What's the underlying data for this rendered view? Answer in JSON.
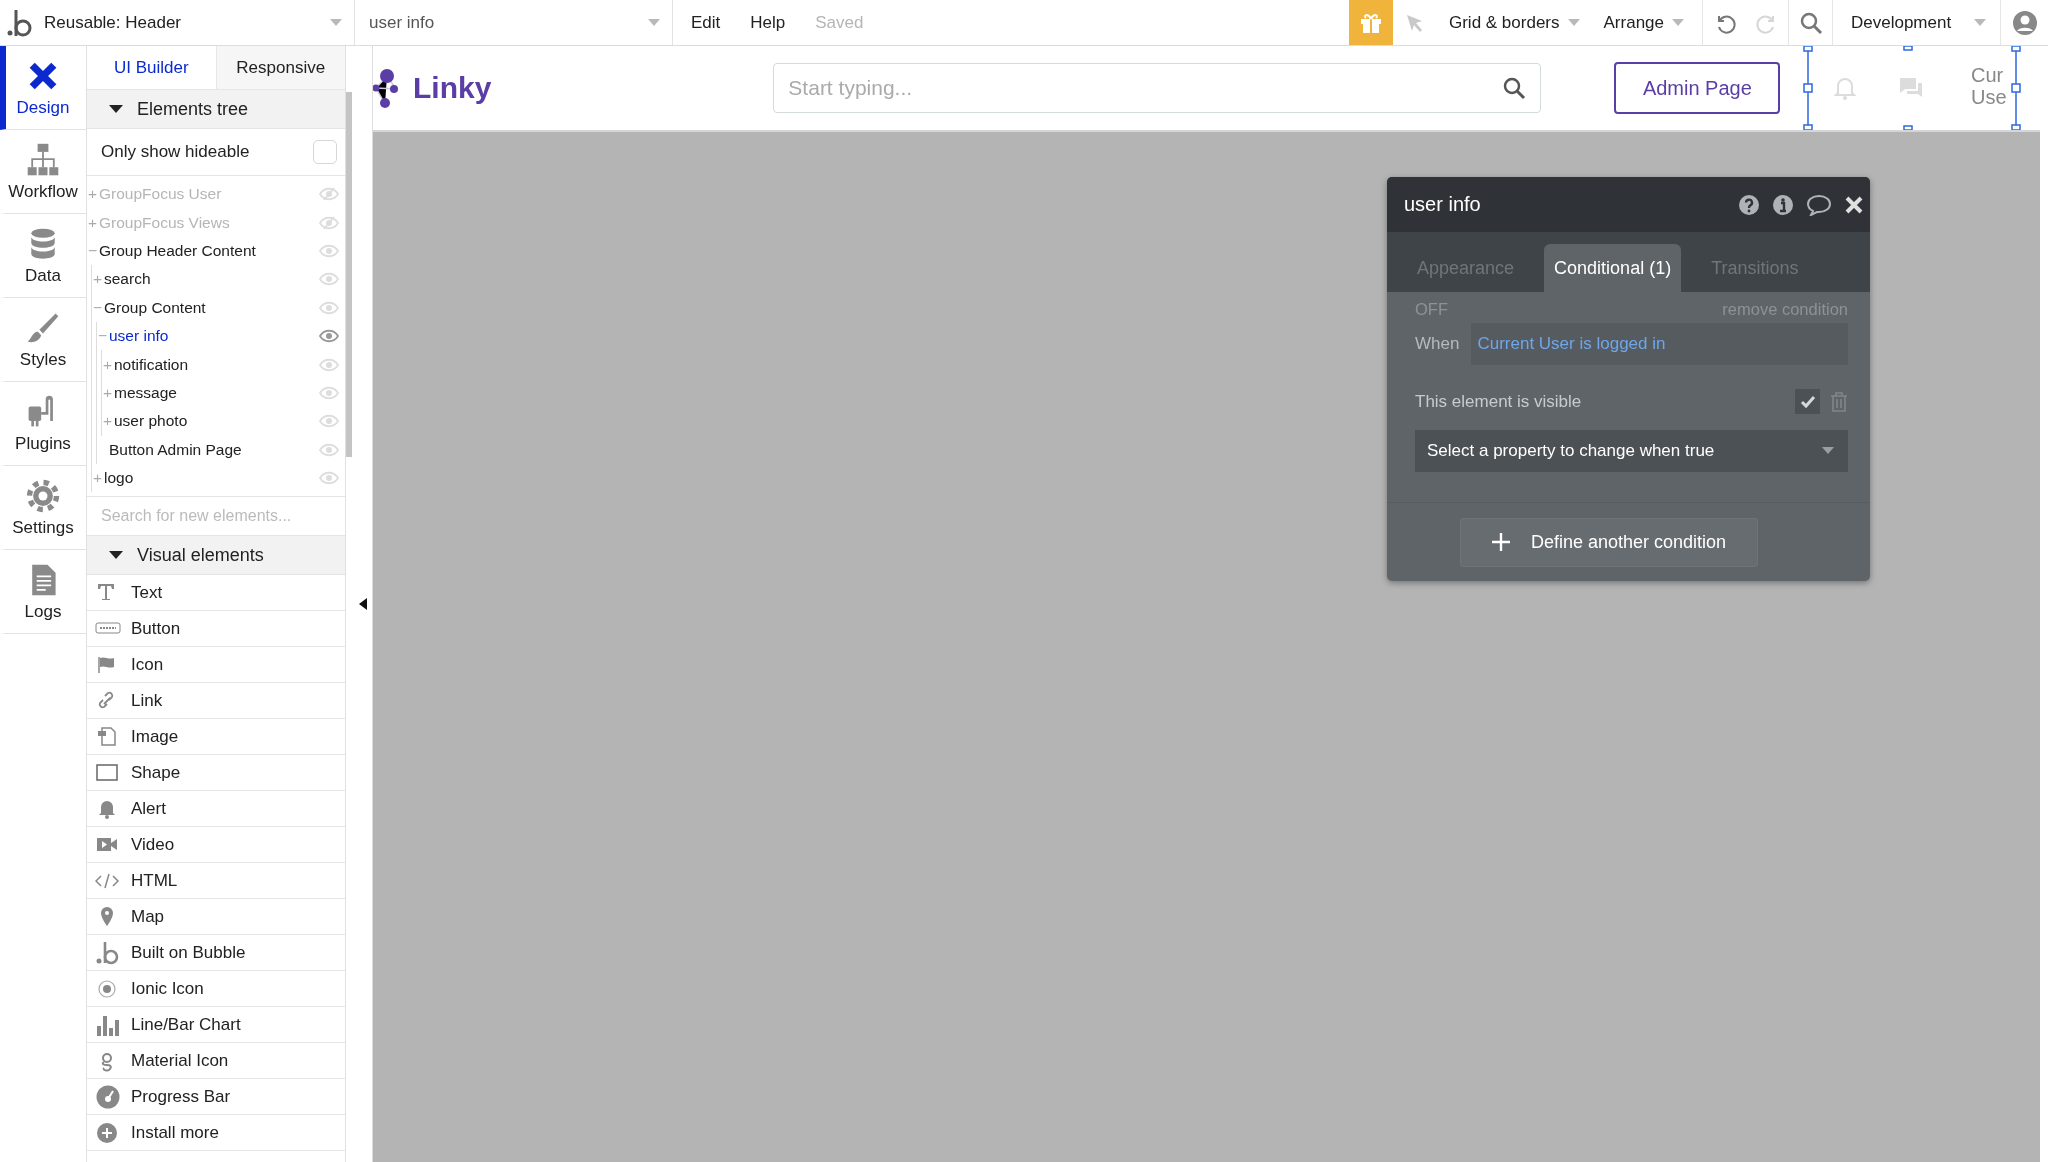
{
  "topbar": {
    "page_selector": "Reusable: Header",
    "element_selector": "user info",
    "menus": [
      {
        "label": "Edit"
      },
      {
        "label": "Help"
      }
    ],
    "save_status": "Saved",
    "grid_menu": "Grid & borders",
    "arrange_menu": "Arrange",
    "redo_disabled": true,
    "environment": "Development"
  },
  "nav": [
    {
      "label": "Design",
      "kind": "design",
      "selected": true
    },
    {
      "label": "Workflow",
      "kind": "workflow",
      "selected": false
    },
    {
      "label": "Data",
      "kind": "data",
      "selected": false
    },
    {
      "label": "Styles",
      "kind": "styles",
      "selected": false
    },
    {
      "label": "Plugins",
      "kind": "plugins",
      "selected": false
    },
    {
      "label": "Settings",
      "kind": "settings",
      "selected": false
    },
    {
      "label": "Logs",
      "kind": "logs",
      "selected": false
    }
  ],
  "panel": {
    "tabs": [
      {
        "label": "UI Builder",
        "selected": true
      },
      {
        "label": "Responsive",
        "selected": false
      }
    ],
    "tree_header": "Elements tree",
    "hideable_filter": {
      "label": "Only show hideable",
      "checked": false
    },
    "tree": [
      {
        "label": "GroupFocus User",
        "toggle": "+",
        "hidden": true,
        "selected": false
      },
      {
        "label": "GroupFocus Views",
        "toggle": "+",
        "hidden": true,
        "selected": false
      },
      {
        "label": "Group Header Content",
        "toggle": "−",
        "hidden": false,
        "selected": false,
        "children": [
          {
            "label": "search",
            "toggle": "+",
            "hidden": false,
            "selected": false
          },
          {
            "label": "Group Content",
            "toggle": "−",
            "hidden": false,
            "selected": false,
            "children": [
              {
                "label": "user info",
                "toggle": "−",
                "hidden": false,
                "selected": true,
                "children": [
                  {
                    "label": "notification",
                    "toggle": "+",
                    "hidden": false,
                    "selected": false
                  },
                  {
                    "label": "message",
                    "toggle": "+",
                    "hidden": false,
                    "selected": false
                  },
                  {
                    "label": "user photo",
                    "toggle": "+",
                    "hidden": false,
                    "selected": false
                  }
                ]
              },
              {
                "label": "Button Admin Page",
                "hidden": false,
                "selected": false
              }
            ]
          },
          {
            "label": "logo",
            "toggle": "+",
            "hidden": false,
            "selected": false
          }
        ]
      }
    ],
    "search_placeholder": "Search for new elements...",
    "visual_header": "Visual elements",
    "visual_elements": [
      {
        "label": "Text",
        "kind": "text"
      },
      {
        "label": "Button",
        "kind": "button"
      },
      {
        "label": "Icon",
        "kind": "flag"
      },
      {
        "label": "Link",
        "kind": "link"
      },
      {
        "label": "Image",
        "kind": "image"
      },
      {
        "label": "Shape",
        "kind": "shape"
      },
      {
        "label": "Alert",
        "kind": "bell"
      },
      {
        "label": "Video",
        "kind": "video"
      },
      {
        "label": "HTML",
        "kind": "code"
      },
      {
        "label": "Map",
        "kind": "pin"
      },
      {
        "label": "Built on Bubble",
        "kind": "bubble"
      },
      {
        "label": "Ionic Icon",
        "kind": "ionic"
      },
      {
        "label": "Line/Bar Chart",
        "kind": "chart"
      },
      {
        "label": "Material Icon",
        "kind": "material"
      },
      {
        "label": "Progress Bar",
        "kind": "gauge"
      },
      {
        "label": "Install more",
        "kind": "plus"
      }
    ]
  },
  "canvas": {
    "logo_text": "Linky",
    "search_placeholder": "Start typing...",
    "admin_button": "Admin Page",
    "user_text": [
      "Cur",
      "Use"
    ]
  },
  "popup": {
    "title": "user info",
    "tabs": [
      {
        "label": "Appearance",
        "selected": false
      },
      {
        "label": "Conditional (1)",
        "selected": true
      },
      {
        "label": "Transitions",
        "selected": false
      }
    ],
    "condition": {
      "state": "OFF",
      "remove_link": "remove condition",
      "when_label": "When",
      "expression": "Current User is logged in",
      "property": {
        "label": "This element is visible",
        "checked": true
      },
      "property_select": "Select a property to change when true"
    },
    "add_button": "Define another condition"
  }
}
